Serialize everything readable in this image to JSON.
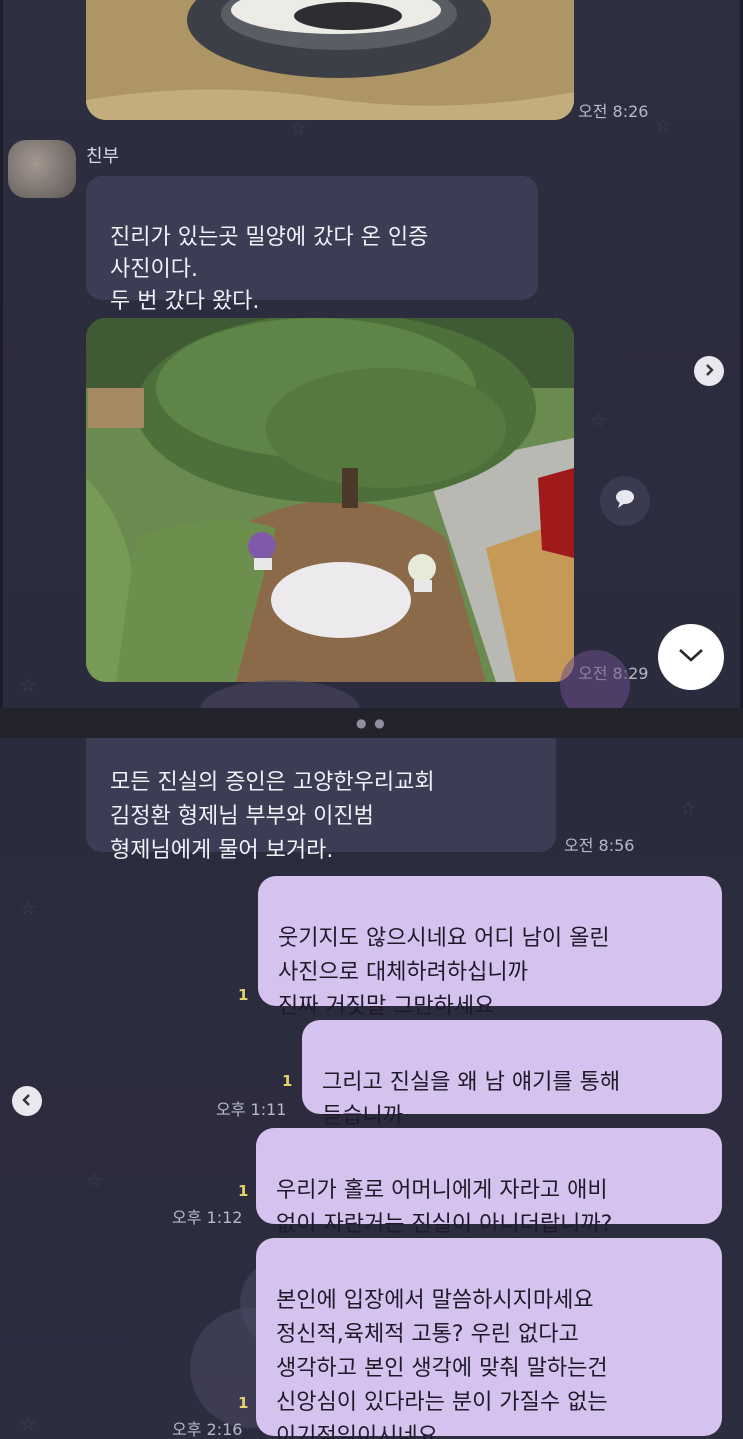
{
  "top": {
    "first_photo_time": "오전 8:26",
    "sender_name": "친부",
    "message": "진리가 있는곳 밀양에 갔다 온 인증\n사진이다.\n두 번 갔다 왔다.",
    "second_photo_time": "오전 8:29"
  },
  "bottom": {
    "incoming": {
      "text": "모든 진실의 증인은 고양한우리교회\n김정환 형제님 부부와 이진범\n형제님에게 물어 보거라.",
      "time": "오전 8:56"
    },
    "outgoing": [
      {
        "text": "웃기지도 않으시네요 어디 남이 올린\n사진으로 대체하려하십니까\n진짜 거짓말 그만하세요",
        "read": "1",
        "time": ""
      },
      {
        "text": "그리고 진실을 왜 남 얘기를 통해\n듣습니까",
        "read": "1",
        "time": "오후 1:11"
      },
      {
        "text": "우리가 홀로 어머니에게 자라고 애비\n없이 자란거는 진실이 아니더랍니까?",
        "read": "1",
        "time": "오후 1:12"
      },
      {
        "text": "본인에 입장에서 말씀하시지마세요\n정신적,육체적 고통? 우린 없다고\n생각하고 본인 생각에 맞춰 말하는건\n신앙심이 있다라는 분이 가질수 없는\n이기적임이시네요",
        "read": "1",
        "time": "오후 2:16"
      }
    ]
  },
  "icons": {
    "forward": "chevron-right-icon",
    "comment": "speech-bubble-icon",
    "scroll_down": "chevron-down-icon",
    "back": "chevron-left-icon"
  },
  "colors": {
    "background": "#2a2b3c",
    "incoming_bubble": "#3c3c54",
    "outgoing_bubble": "#d5c2ee",
    "read_count": "#e6d36a"
  }
}
